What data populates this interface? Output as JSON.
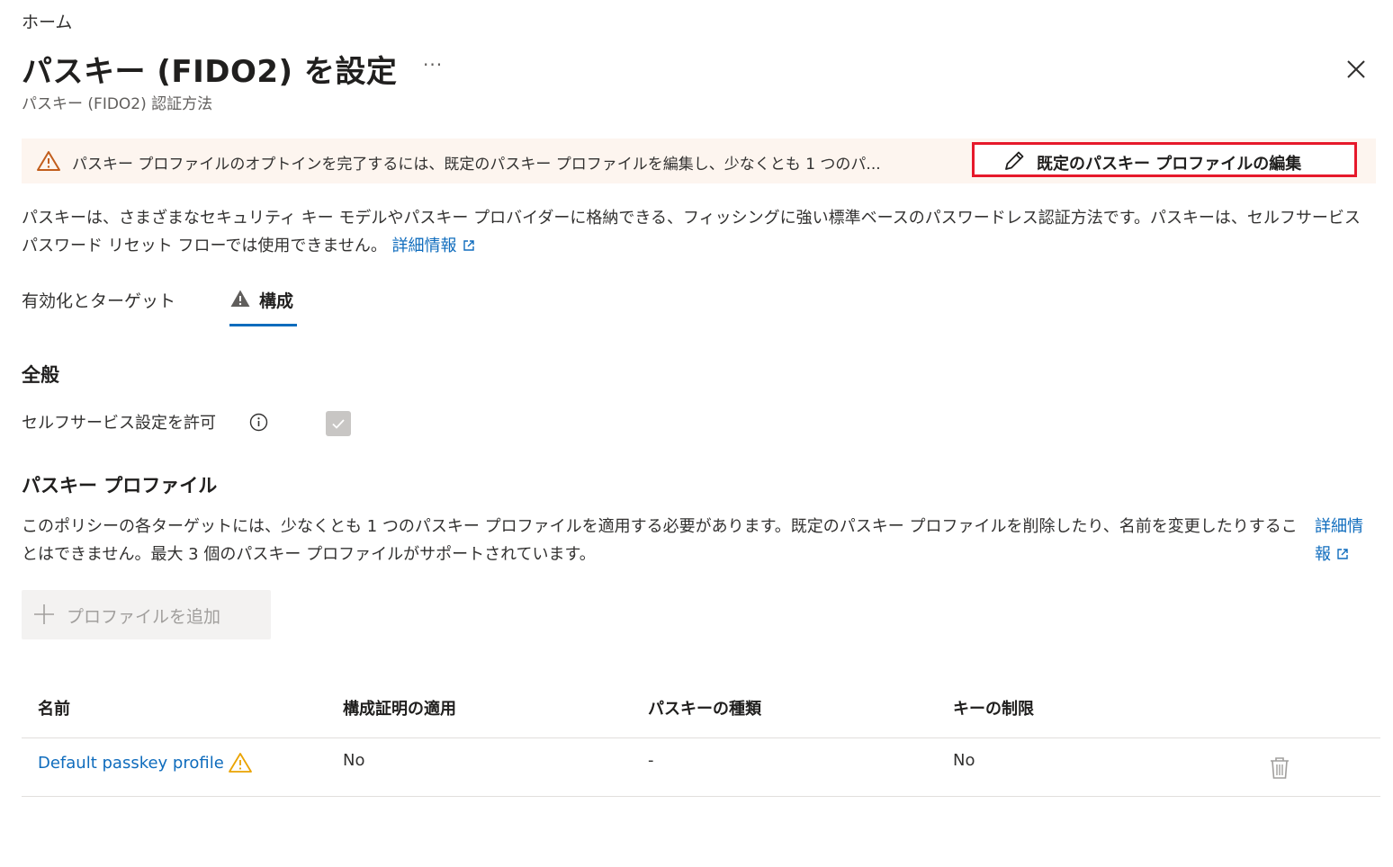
{
  "breadcrumb": "ホーム",
  "header": {
    "title": "パスキー (FIDO2) を設定",
    "more": "···",
    "subtitle": "パスキー (FIDO2) 認証方法"
  },
  "banner": {
    "text": "パスキー プロファイルのオプトインを完了するには、既定のパスキー プロファイルを編集し、少なくとも 1 つのパ...",
    "button_label": "既定のパスキー プロファイルの編集"
  },
  "description": {
    "text": "パスキーは、さまざまなセキュリティ キー モデルやパスキー プロバイダーに格納できる、フィッシングに強い標準ベースのパスワードレス認証方法です。パスキーは、セルフサービス パスワード リセット フローでは使用できません。",
    "link": "詳細情報"
  },
  "tabs": [
    {
      "label": "有効化とターゲット",
      "selected": false
    },
    {
      "label": "構成",
      "selected": true
    }
  ],
  "general": {
    "heading": "全般",
    "allow_self_service_label": "セルフサービス設定を許可",
    "allow_self_service_checked": true
  },
  "passkey_profiles": {
    "heading": "パスキー プロファイル",
    "description": "このポリシーの各ターゲットには、少なくとも 1 つのパスキー プロファイルを適用する必要があります。既定のパスキー プロファイルを削除したり、名前を変更したりすることはできません。最大 3 個のパスキー プロファイルがサポートされています。",
    "link": "詳細情報",
    "add_button": "プロファイルを追加"
  },
  "table": {
    "columns": [
      "名前",
      "構成証明の適用",
      "パスキーの種類",
      "キーの制限"
    ],
    "rows": [
      {
        "name": "Default passkey profile",
        "attestation": "No",
        "type": "-",
        "key_restriction": "No"
      }
    ]
  },
  "colors": {
    "link": "#0f6cbd",
    "banner_bg": "#fdf5ef",
    "warning": "#c25e1d",
    "highlight_border": "#e6192b",
    "tab_underline": "#0f6cbd"
  }
}
